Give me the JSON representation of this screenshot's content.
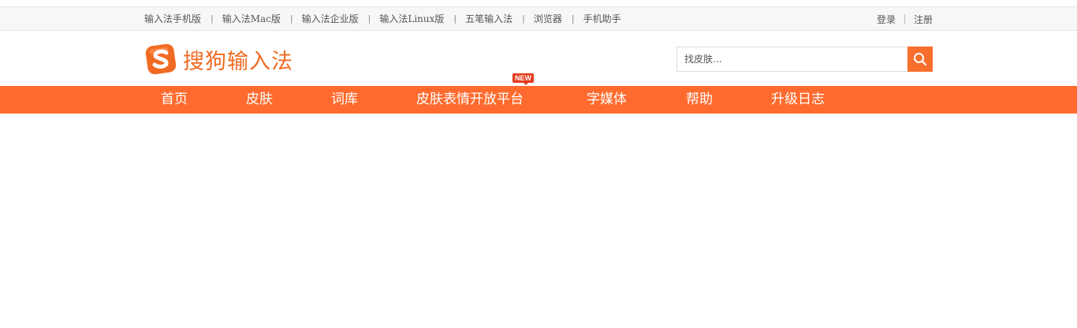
{
  "topbar": {
    "links": [
      "输入法手机版",
      "输入法Mac版",
      "输入法企业版",
      "输入法Linux版",
      "五笔输入法",
      "浏览器",
      "手机助手"
    ],
    "separator": "|",
    "login": "登录",
    "register": "注册"
  },
  "brand": {
    "name": "搜狗输入法",
    "color": "#f26a22",
    "icon": "sogou-s-logo-icon"
  },
  "search": {
    "placeholder": "找皮肤...",
    "button_icon": "search-icon",
    "button_color": "#f86e2d"
  },
  "nav": {
    "bg_color": "#ff6b2e",
    "items": [
      "首页",
      "皮肤",
      "词库",
      "皮肤表情开放平台",
      "字媒体",
      "帮助",
      "升级日志"
    ],
    "badge": "NEW",
    "badge_color": "#e53a1a"
  }
}
